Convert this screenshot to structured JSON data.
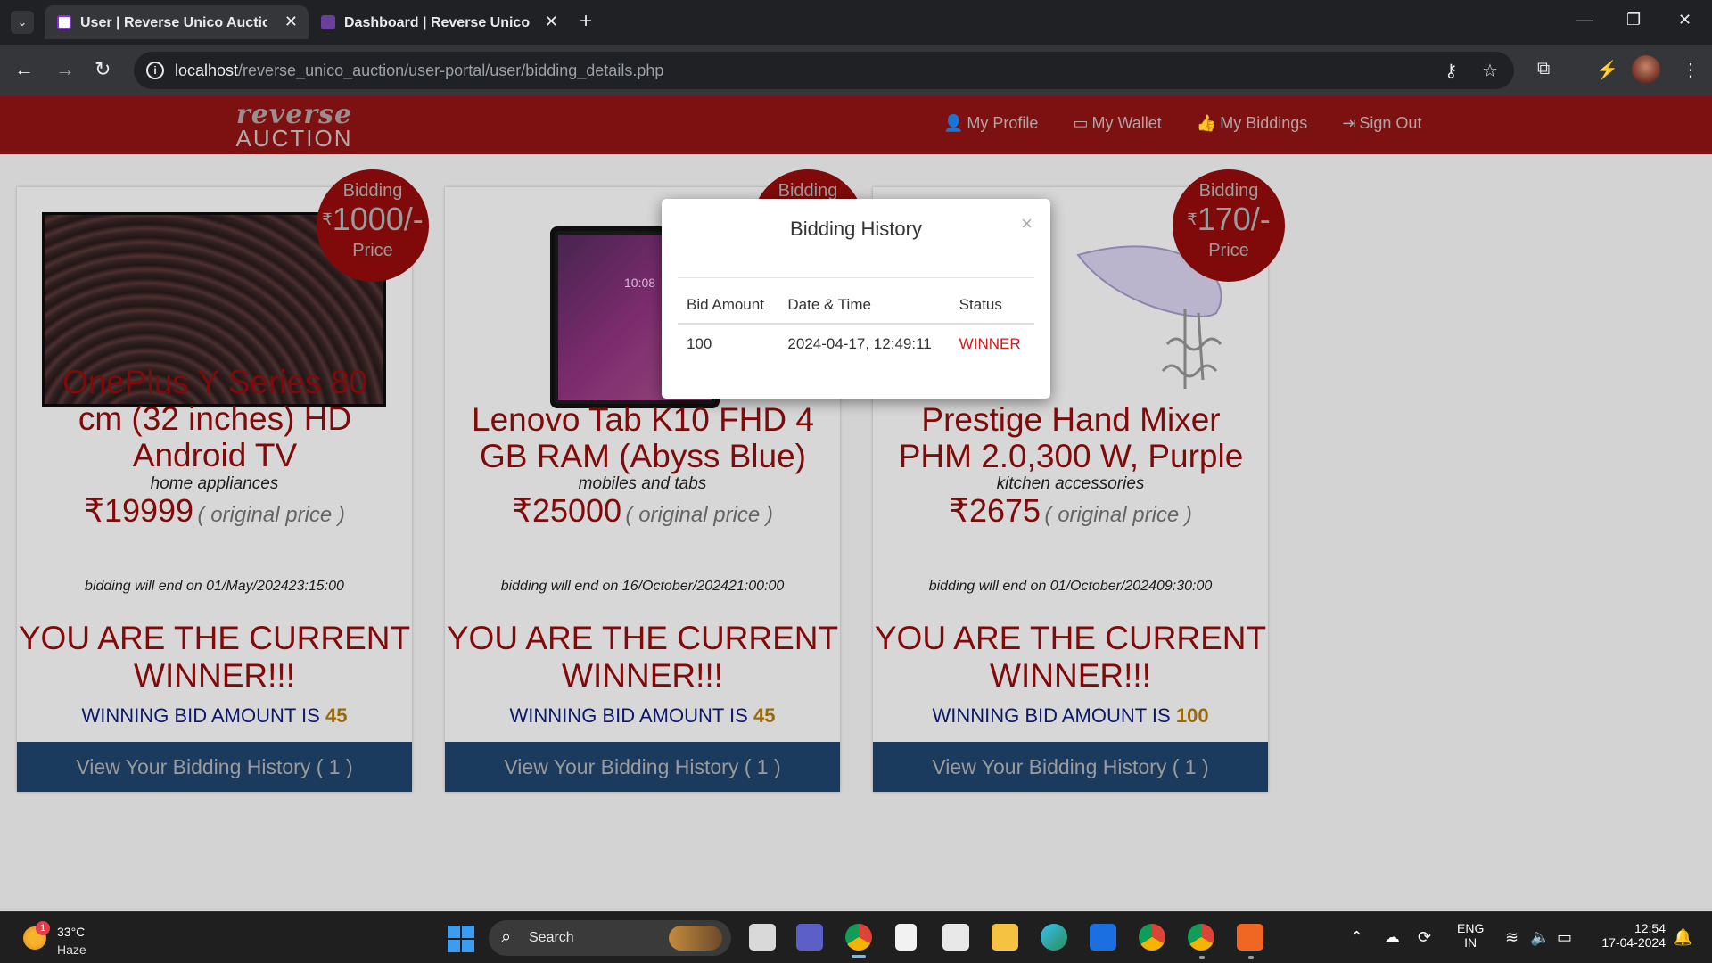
{
  "browser": {
    "tabs": [
      {
        "title": "User | Reverse Unico Auction",
        "active": true
      },
      {
        "title": "Dashboard | Reverse Unico Auction",
        "active": false
      }
    ],
    "url_host": "localhost",
    "url_path": "/reverse_unico_auction/user-portal/user/bidding_details.php"
  },
  "site": {
    "logo_top": "reverse",
    "logo_bottom": "AUCTION",
    "nav": [
      {
        "label": "My Profile",
        "icon": "user-icon"
      },
      {
        "label": "My Wallet",
        "icon": "wallet-icon"
      },
      {
        "label": "My Biddings",
        "icon": "thumbs-up-icon"
      },
      {
        "label": "Sign Out",
        "icon": "sign-out-icon"
      }
    ]
  },
  "cards": [
    {
      "badge_top": "Bidding",
      "badge_price": "1000/-",
      "badge_bottom": "Price",
      "name": "OnePlus Y Series 80 cm (32 inches) HD Android TV",
      "category": "home appliances",
      "price": "₹19999",
      "original_label": "( original price )",
      "end": "bidding will end on 01/May/202423:15:00",
      "winner": "YOU ARE THE CURRENT WINNER!!!",
      "bid_label": "WINNING BID AMOUNT IS",
      "bid_value": "45",
      "history_button": "View Your Bidding History ( 1 )"
    },
    {
      "badge_top": "Bidding",
      "badge_price": "",
      "badge_bottom": "",
      "name": "Lenovo Tab K10 FHD 4 GB RAM (Abyss Blue)",
      "category": "mobiles and tabs",
      "price": "₹25000",
      "original_label": "( original price )",
      "end": "bidding will end on 16/October/202421:00:00",
      "winner": "YOU ARE THE CURRENT WINNER!!!",
      "bid_label": "WINNING BID AMOUNT IS",
      "bid_value": "45",
      "history_button": "View Your Bidding History ( 1 )"
    },
    {
      "badge_top": "Bidding",
      "badge_price": "170/-",
      "badge_bottom": "Price",
      "name": "Prestige Hand Mixer PHM 2.0,300 W, Purple",
      "category": "kitchen accessories",
      "price": "₹2675",
      "original_label": "( original price )",
      "end": "bidding will end on 01/October/202409:30:00",
      "winner": "YOU ARE THE CURRENT WINNER!!!",
      "bid_label": "WINNING BID AMOUNT IS",
      "bid_value": "100",
      "history_button": "View Your Bidding History ( 1 )"
    }
  ],
  "modal": {
    "title": "Bidding History",
    "close": "×",
    "headers": [
      "Bid Amount",
      "Date & Time",
      "Status"
    ],
    "rows": [
      {
        "amount": "100",
        "datetime": "2024-04-17, 12:49:11",
        "status": "WINNER"
      }
    ]
  },
  "taskbar": {
    "weather_temp": "33°C",
    "weather_desc": "Haze",
    "weather_badge": "1",
    "search": "Search",
    "lang_1": "ENG",
    "lang_2": "IN",
    "time": "12:54",
    "date": "17-04-2024"
  },
  "colors": {
    "header": "#7d1111",
    "accent_red": "#8a0b0b",
    "button_blue": "#1c3f66",
    "winner_red": "#d11a1a"
  }
}
